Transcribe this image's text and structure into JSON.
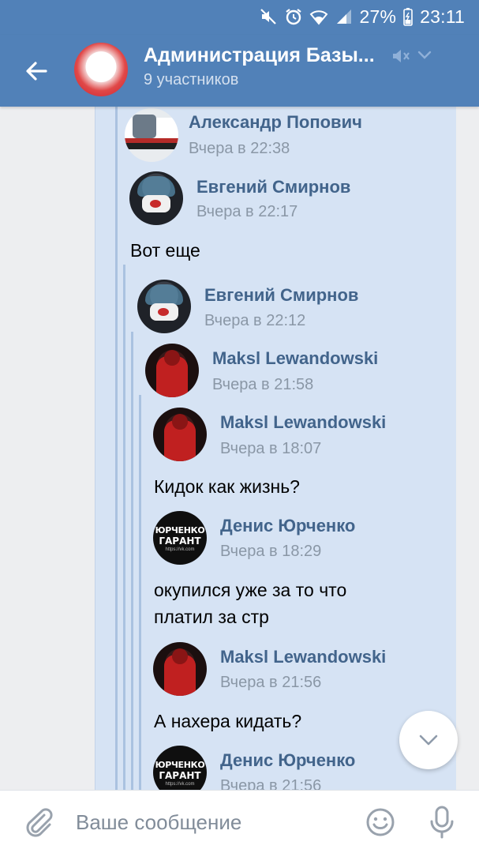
{
  "status_bar": {
    "battery": "27%",
    "time": "23:11",
    "icons": [
      "mute-icon",
      "alarm-icon",
      "wifi-icon",
      "signal-icon",
      "battery-icon"
    ]
  },
  "header": {
    "title": "Администрация Базы...",
    "subtitle": "9 участников",
    "avatar_icon": "group-avatar",
    "icons": [
      "back-arrow-icon",
      "muted-speaker-icon",
      "chevron-down-icon"
    ]
  },
  "messages": [
    {
      "author": "Александр Попович",
      "time": "Вчера в 22:38",
      "avatar": "avatar-aleksandr",
      "text": ""
    },
    {
      "author": "Евгений Смирнов",
      "time": "Вчера в 22:17",
      "avatar": "avatar-evgeniy",
      "text": "Вот еще"
    },
    {
      "author": "Евгений Смирнов",
      "time": "Вчера в 22:12",
      "avatar": "avatar-evgeniy",
      "text": ""
    },
    {
      "author": "Maksl Lewandowski",
      "time": "Вчера в 21:58",
      "avatar": "avatar-maksl",
      "text": ""
    },
    {
      "author": "Maksl Lewandowski",
      "time": "Вчера в 18:07",
      "avatar": "avatar-maksl",
      "text": "Кидок как жизнь?"
    },
    {
      "author": "Денис Юрченко",
      "time": "Вчера в 18:29",
      "avatar": "avatar-denis",
      "text_lines": [
        "окупился уже за то что",
        "платил за стр"
      ]
    },
    {
      "author": "Maksl Lewandowski",
      "time": "Вчера в 21:56",
      "avatar": "avatar-maksl",
      "text": "А нахера кидать?"
    },
    {
      "author": "Денис Юрченко",
      "time": "Вчера в 21:56",
      "avatar": "avatar-denis",
      "text": ""
    }
  ],
  "composer": {
    "placeholder": "Ваше сообщение",
    "icons": [
      "attach-icon",
      "emoji-icon",
      "microphone-icon"
    ]
  },
  "colors": {
    "header_bg": "#5181b8",
    "bubble_bg": "#d6e3f4",
    "author_name": "#42648b",
    "time": "#8a97a6",
    "thread_line": "#aac2e0"
  }
}
